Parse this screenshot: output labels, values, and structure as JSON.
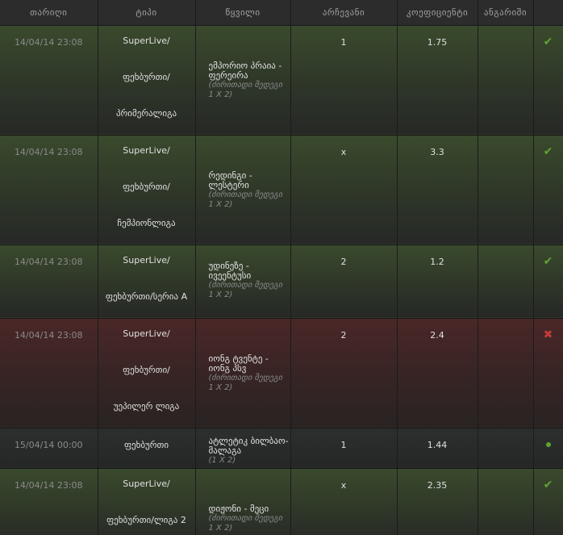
{
  "headers": [
    "თარიღი",
    "ტიპი",
    "წყვილი",
    "არჩევანი",
    "კოეფიციენტი",
    "ანგარიში"
  ],
  "rows": [
    {
      "state": "win",
      "date": "14/04/14 23:08",
      "type": [
        "SuperLive/",
        "ფეხბურთი/",
        "პრიმერალიგა"
      ],
      "event": "ემპორიო პრაია - ფერეირა",
      "sub": "(ძირითადი მედეგი 1 X 2)",
      "choice": "1",
      "odds": "1.75",
      "status": "check"
    },
    {
      "state": "win",
      "date": "14/04/14 23:08",
      "type": [
        "SuperLive/",
        "ფეხბურთი/",
        "ჩემპიონლიგა"
      ],
      "event": "რედინგი - ლესტერი",
      "sub": "(ძირითადი მედეგი 1 X 2)",
      "choice": "x",
      "odds": "3.3",
      "status": "check"
    },
    {
      "state": "win",
      "date": "14/04/14 23:08",
      "type": [
        "SuperLive/",
        "ფეხბურთი/სერია A"
      ],
      "event": "უდინეზე - ივეენტუსი",
      "sub": "(ძირითადი მედეგი 1 X 2)",
      "choice": "2",
      "odds": "1.2",
      "status": "check"
    },
    {
      "state": "loss",
      "date": "14/04/14 23:08",
      "type": [
        "SuperLive/",
        "ფეხბურთი/",
        "უეპილერ ლიგა"
      ],
      "event": "იონგ ტვენტე - იონგ პსვ",
      "sub": "(ძირითადი მედეგი 1 X 2)",
      "choice": "2",
      "odds": "2.4",
      "status": "cross"
    },
    {
      "state": "pending",
      "date": "15/04/14 00:00",
      "type": [
        "ფეხბურთი"
      ],
      "event": "ატლეტიკ ბილბაო-მალაგა",
      "sub": "(1 X 2)",
      "choice": "1",
      "odds": "1.44",
      "status": "dot"
    },
    {
      "state": "win",
      "date": "14/04/14 23:08",
      "type": [
        "SuperLive/",
        "ფეხბურთი/ლიგა 2"
      ],
      "event": "დიჟონი - მეცი",
      "sub": "(ძირითადი მედეგი 1 X 2)",
      "choice": "x",
      "odds": "2.35",
      "status": "check"
    }
  ]
}
